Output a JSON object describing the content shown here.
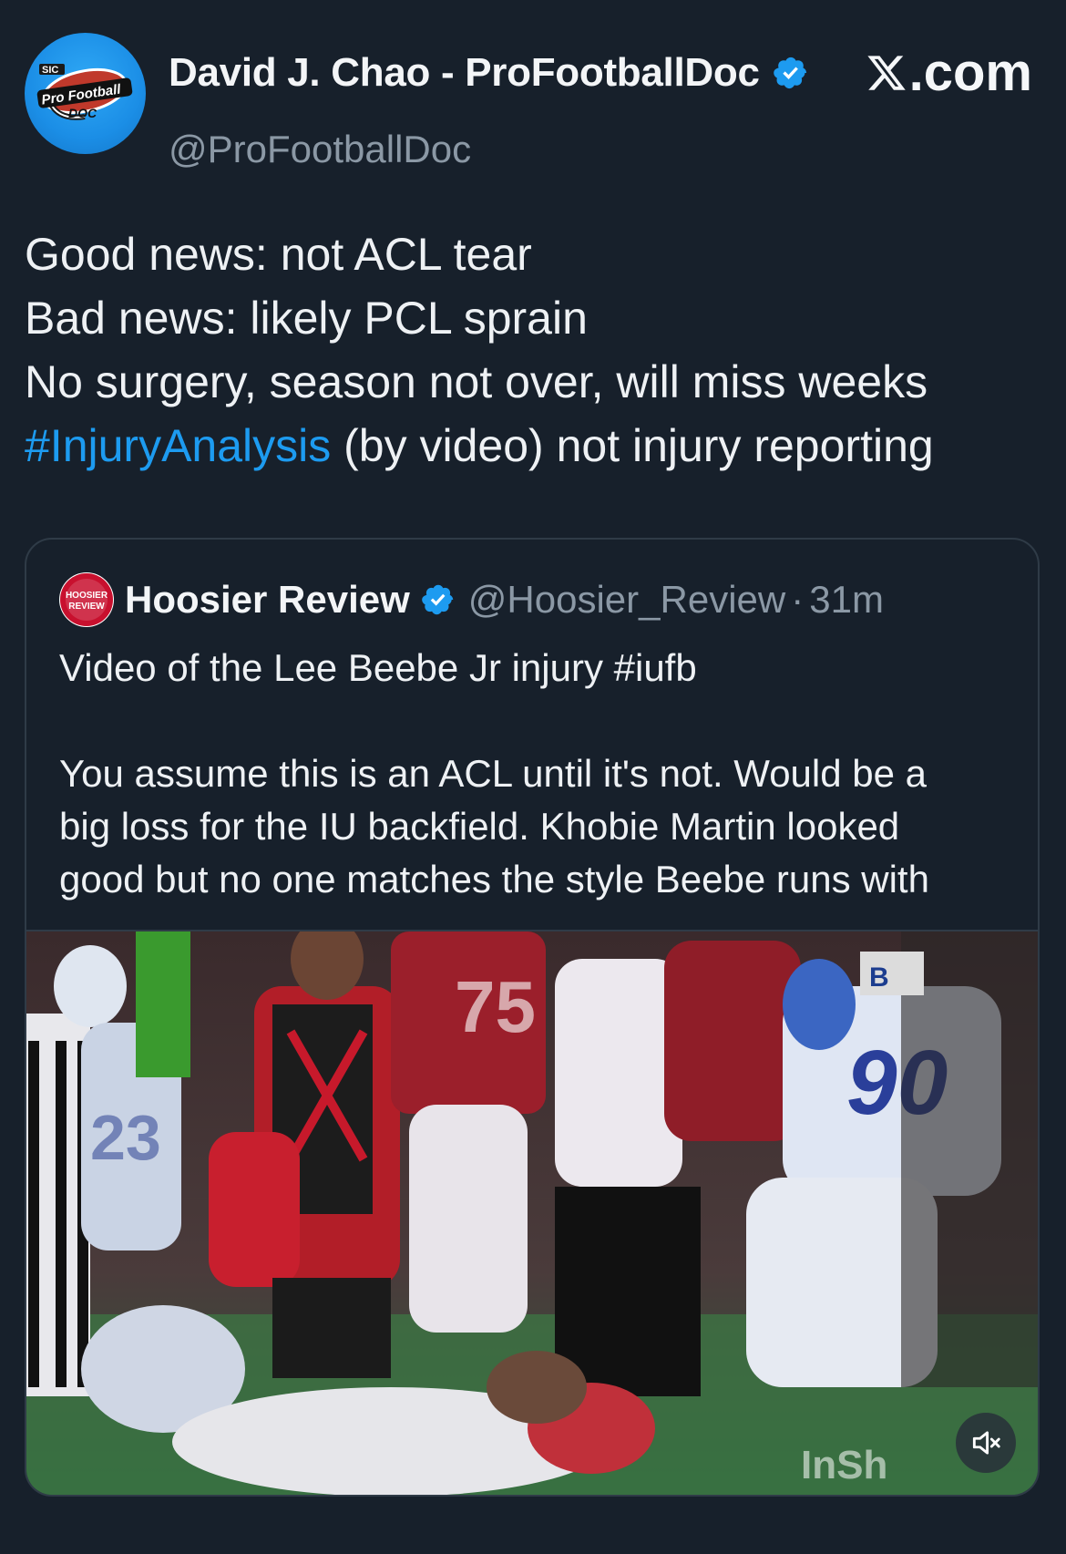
{
  "author": {
    "name": "David J. Chao - ProFootballDoc",
    "handle": "@ProFootballDoc",
    "verified": true,
    "avatar_logo_text": [
      "SIC",
      "Pro Football",
      "DOC"
    ]
  },
  "brand": {
    "site": ".com",
    "logo_icon": "x-logo-icon"
  },
  "tweet": {
    "lines": [
      "Good news: not ACL tear",
      "Bad news: likely PCL sprain",
      "No surgery, season not over, will miss weeks"
    ],
    "hashtag": "#InjuryAnalysis",
    "hashtag_tail": " (by video) not injury reporting"
  },
  "quote": {
    "name": "Hoosier Review",
    "handle": "@Hoosier_Review",
    "separator": "·",
    "time": "31m",
    "verified": true,
    "avatar_logo_text": [
      "HOOSIER",
      "REVIEW"
    ],
    "line1": "Video of the Lee Beebe Jr injury #iufb",
    "body": [
      "You assume this is an ACL until it's not.  Would be a",
      "big loss for the IU backfield.  Khobie Martin looked",
      "good but no one matches the style Beebe runs with"
    ]
  },
  "media": {
    "type": "video",
    "jersey_numbers": [
      "75",
      "90",
      "23"
    ],
    "overlay_text": "InSh",
    "badge_text": "B",
    "controls": {
      "mute_icon": "speaker-muted-icon"
    }
  },
  "colors": {
    "background": "#17202b",
    "link": "#1d9bf0",
    "secondary_text": "#8b98a5",
    "verified": "#1d9bf0"
  }
}
